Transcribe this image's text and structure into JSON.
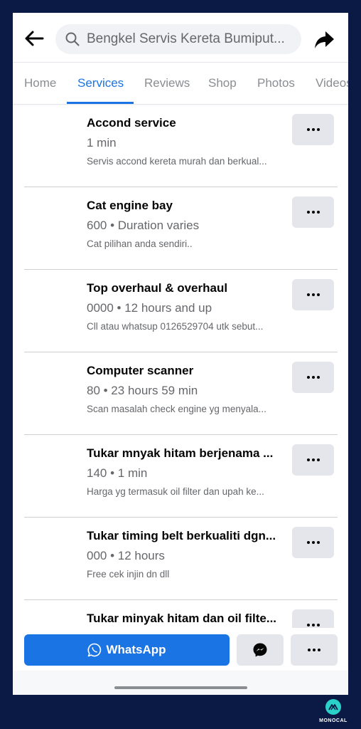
{
  "header": {
    "search_text": "Bengkel Servis Kereta Bumiput..."
  },
  "tabs": [
    {
      "label": "Home",
      "active": false
    },
    {
      "label": "Services",
      "active": true
    },
    {
      "label": "Reviews",
      "active": false
    },
    {
      "label": "Shop",
      "active": false
    },
    {
      "label": "Photos",
      "active": false
    },
    {
      "label": "Videos",
      "active": false
    }
  ],
  "services": [
    {
      "title": "Accond service",
      "meta": "1 min",
      "description": "Servis accond kereta murah dan berkual..."
    },
    {
      "title": "Cat engine bay",
      "meta": "600 • Duration varies",
      "description": "Cat pilihan anda sendiri.."
    },
    {
      "title": "Top overhaul & overhaul",
      "meta": "0000 • 12 hours and up",
      "description": "Cll atau whatsup 0126529704 utk sebut..."
    },
    {
      "title": "Computer scanner",
      "meta": "80 • 23 hours 59 min",
      "description": "Scan masalah check engine yg menyala..."
    },
    {
      "title": "Tukar mnyak hitam berjenama ...",
      "meta": "140 • 1 min",
      "description": "Harga yg termasuk oil filter dan upah ke..."
    },
    {
      "title": "Tukar timing belt berkualiti dgn...",
      "meta": "000 • 12 hours",
      "description": "Free cek injin dn dll"
    },
    {
      "title": "Tukar minyak hitam dan oil filte...",
      "meta": "",
      "description": ""
    }
  ],
  "actions": {
    "whatsapp_label": "WhatsApp"
  },
  "watermark": {
    "brand": "MONOCAL"
  },
  "colors": {
    "accent": "#1b74e4",
    "background": "#0b1a44",
    "button_gray": "#e4e6eb",
    "brand_teal": "#2ad1c9"
  }
}
